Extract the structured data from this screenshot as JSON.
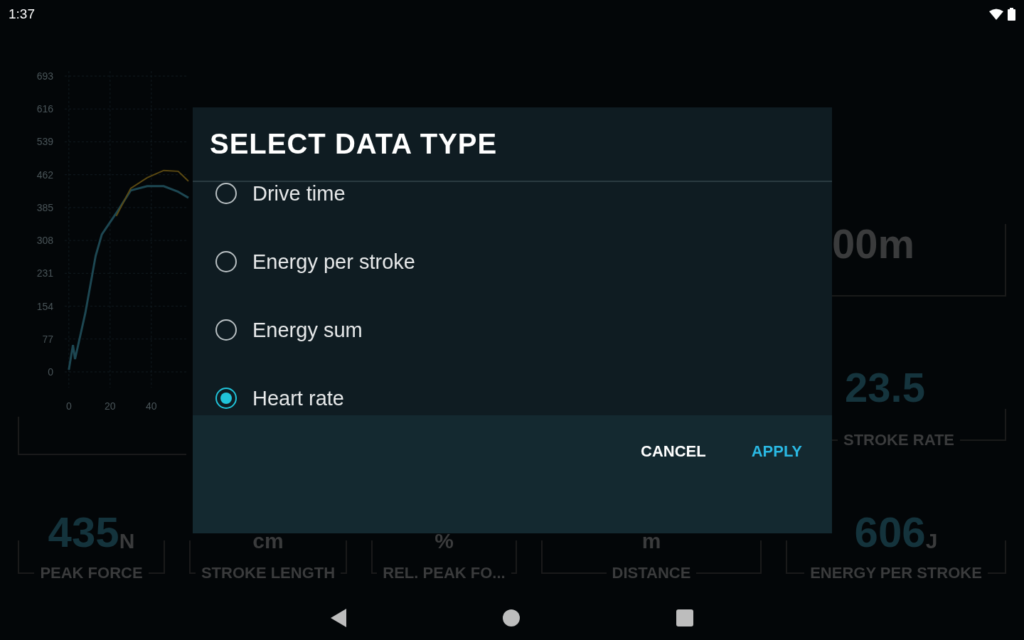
{
  "status_bar": {
    "time": "1:37"
  },
  "chart": {
    "chart_data": {
      "type": "line",
      "x": [
        0,
        2,
        3,
        8,
        13,
        16,
        23,
        30,
        38,
        46,
        53,
        58
      ],
      "xticks": [
        0,
        20,
        40
      ],
      "yticks": [
        0,
        77,
        154,
        231,
        308,
        385,
        462,
        539,
        616,
        693
      ],
      "xlim": [
        -2,
        58
      ],
      "ylim": [
        0,
        693
      ],
      "grid": true,
      "series": [
        {
          "color": "#1d4752",
          "values": [
            5,
            63,
            30,
            138,
            272,
            322,
            372,
            425,
            435,
            435,
            422,
            408
          ]
        },
        {
          "color": "#5c4a12",
          "values": [
            null,
            null,
            null,
            null,
            null,
            null,
            365,
            430,
            455,
            472,
            470,
            447
          ]
        }
      ]
    }
  },
  "side_tiles": [
    {
      "value": "00m"
    },
    {
      "value": "23.5",
      "label": "STROKE RATE"
    }
  ],
  "bottom_tiles": [
    {
      "value": "435",
      "unit": "N",
      "label": "PEAK FORCE"
    },
    {
      "unit": "cm",
      "label": "STROKE LENGTH"
    },
    {
      "unit": "%",
      "label": "REL. PEAK FO..."
    },
    {
      "unit": "m",
      "label": "DISTANCE"
    },
    {
      "value": "606",
      "unit": "J",
      "label": "ENERGY PER STROKE"
    }
  ],
  "dialog": {
    "title": "SELECT DATA TYPE",
    "options": [
      {
        "label": "Drive time",
        "selected": false
      },
      {
        "label": "Energy per stroke",
        "selected": false
      },
      {
        "label": "Energy sum",
        "selected": false
      },
      {
        "label": "Heart rate",
        "selected": true
      }
    ],
    "buttons": [
      {
        "label": "CANCEL",
        "kind": "neutral"
      },
      {
        "label": "APPLY",
        "kind": "primary"
      }
    ]
  }
}
